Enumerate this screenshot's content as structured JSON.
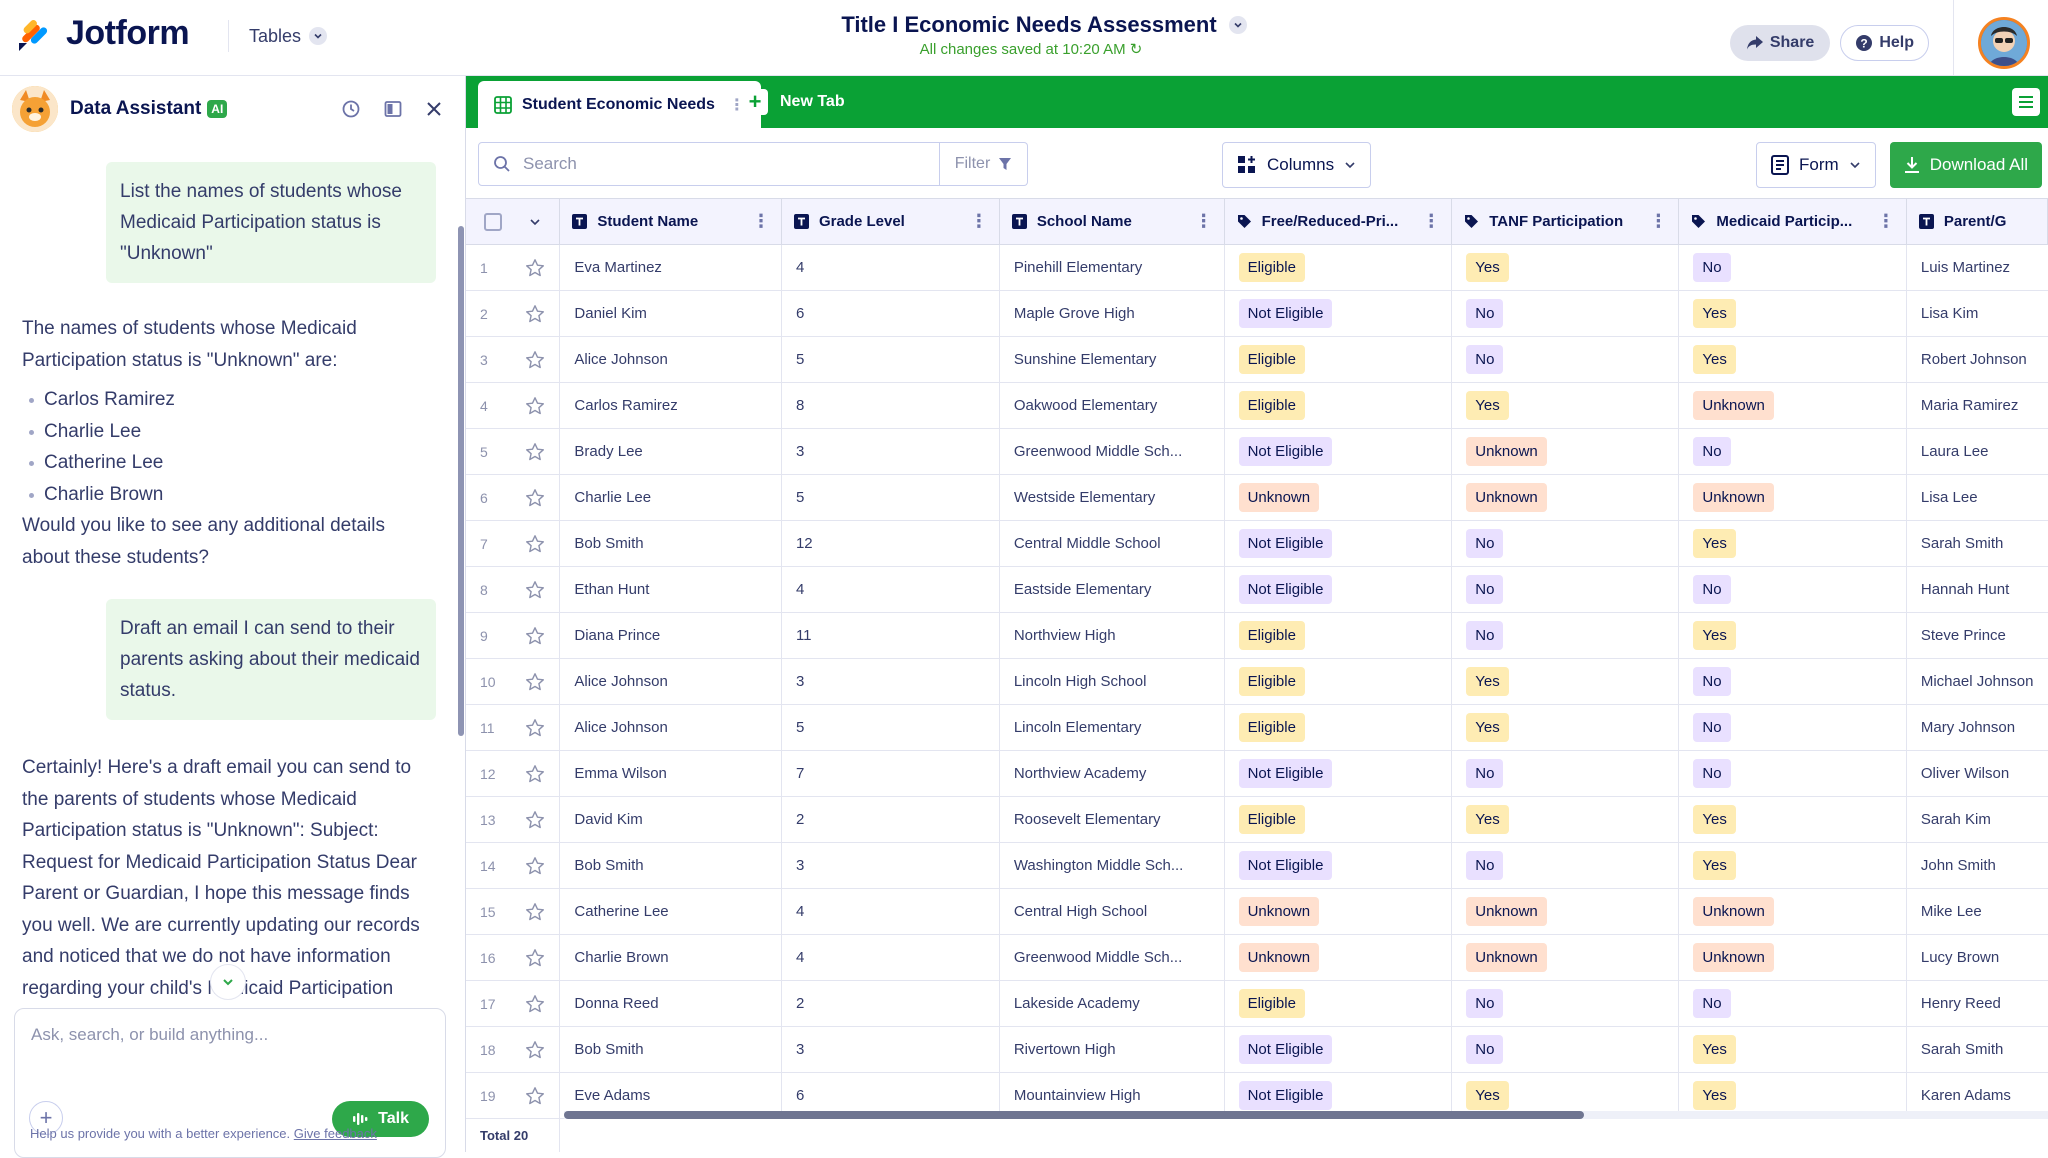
{
  "app": {
    "brand": "Jotform",
    "menu_label": "Tables"
  },
  "document": {
    "title": "Title I Economic Needs Assessment",
    "saved_status": "All changes saved at 10:20 AM"
  },
  "header_actions": {
    "share": "Share",
    "help": "Help"
  },
  "assistant": {
    "name": "Data Assistant",
    "badge": "AI",
    "messages": [
      {
        "role": "user",
        "text": "List the names of students whose Medicaid Participation status is \"Unknown\""
      },
      {
        "role": "assistant",
        "text": "The names of students whose Medicaid Participation status is \"Unknown\" are:",
        "list": [
          "Carlos Ramirez",
          "Charlie Lee",
          "Catherine Lee",
          "Charlie Brown"
        ],
        "after": "Would you like to see any additional details about these students?"
      },
      {
        "role": "user",
        "text": "Draft an email I can send to their parents asking about their medicaid status."
      },
      {
        "role": "assistant",
        "text": "Certainly! Here's a draft email you can send to the parents of students whose Medicaid Participation status is \"Unknown\": Subject: Request for Medicaid Participation Status Dear Parent or Guardian, I hope this message finds you well. We are currently updating our records and noticed that we do not have information regarding your child's Medicaid Participation"
      }
    ],
    "input_placeholder": "Ask, search, or build anything...",
    "talk_label": "Talk",
    "feedback_text": "Help us provide you with a better experience.",
    "feedback_link": "Give feedback"
  },
  "tabs": {
    "active": "Student Economic Needs",
    "new_tab": "New Tab"
  },
  "toolbar": {
    "search_placeholder": "Search",
    "filter": "Filter",
    "columns": "Columns",
    "form": "Form",
    "download": "Download All"
  },
  "table": {
    "columns": [
      "Student Name",
      "Grade Level",
      "School Name",
      "Free/Reduced-Pri...",
      "TANF Participation",
      "Medicaid Particip...",
      "Parent/G"
    ],
    "rows": [
      {
        "num": "1",
        "name": "Eva Martinez",
        "grade": "4",
        "school": "Pinehill Elementary",
        "frl": "Eligible",
        "tanf": "Yes",
        "medicaid": "No",
        "parent": "Luis Martinez"
      },
      {
        "num": "2",
        "name": "Daniel Kim",
        "grade": "6",
        "school": "Maple Grove High",
        "frl": "Not Eligible",
        "tanf": "No",
        "medicaid": "Yes",
        "parent": "Lisa Kim"
      },
      {
        "num": "3",
        "name": "Alice Johnson",
        "grade": "5",
        "school": "Sunshine Elementary",
        "frl": "Eligible",
        "tanf": "No",
        "medicaid": "Yes",
        "parent": "Robert Johnson"
      },
      {
        "num": "4",
        "name": "Carlos Ramirez",
        "grade": "8",
        "school": "Oakwood Elementary",
        "frl": "Eligible",
        "tanf": "Yes",
        "medicaid": "Unknown",
        "parent": "Maria Ramirez"
      },
      {
        "num": "5",
        "name": "Brady Lee",
        "grade": "3",
        "school": "Greenwood Middle Sch...",
        "frl": "Not Eligible",
        "tanf": "Unknown",
        "medicaid": "No",
        "parent": "Laura Lee"
      },
      {
        "num": "6",
        "name": "Charlie Lee",
        "grade": "5",
        "school": "Westside Elementary",
        "frl": "Unknown",
        "tanf": "Unknown",
        "medicaid": "Unknown",
        "parent": "Lisa Lee"
      },
      {
        "num": "7",
        "name": "Bob Smith",
        "grade": "12",
        "school": "Central Middle School",
        "frl": "Not Eligible",
        "tanf": "No",
        "medicaid": "Yes",
        "parent": "Sarah Smith"
      },
      {
        "num": "8",
        "name": "Ethan Hunt",
        "grade": "4",
        "school": "Eastside Elementary",
        "frl": "Not Eligible",
        "tanf": "No",
        "medicaid": "No",
        "parent": "Hannah Hunt"
      },
      {
        "num": "9",
        "name": "Diana Prince",
        "grade": "11",
        "school": "Northview High",
        "frl": "Eligible",
        "tanf": "No",
        "medicaid": "Yes",
        "parent": "Steve Prince"
      },
      {
        "num": "10",
        "name": "Alice Johnson",
        "grade": "3",
        "school": "Lincoln High School",
        "frl": "Eligible",
        "tanf": "Yes",
        "medicaid": "No",
        "parent": "Michael Johnson"
      },
      {
        "num": "11",
        "name": "Alice Johnson",
        "grade": "5",
        "school": "Lincoln Elementary",
        "frl": "Eligible",
        "tanf": "Yes",
        "medicaid": "No",
        "parent": "Mary Johnson"
      },
      {
        "num": "12",
        "name": "Emma Wilson",
        "grade": "7",
        "school": "Northview Academy",
        "frl": "Not Eligible",
        "tanf": "No",
        "medicaid": "No",
        "parent": "Oliver Wilson"
      },
      {
        "num": "13",
        "name": "David Kim",
        "grade": "2",
        "school": "Roosevelt Elementary",
        "frl": "Eligible",
        "tanf": "Yes",
        "medicaid": "Yes",
        "parent": "Sarah Kim"
      },
      {
        "num": "14",
        "name": "Bob Smith",
        "grade": "3",
        "school": "Washington Middle Sch...",
        "frl": "Not Eligible",
        "tanf": "No",
        "medicaid": "Yes",
        "parent": "John Smith"
      },
      {
        "num": "15",
        "name": "Catherine Lee",
        "grade": "4",
        "school": "Central High School",
        "frl": "Unknown",
        "tanf": "Unknown",
        "medicaid": "Unknown",
        "parent": "Mike Lee"
      },
      {
        "num": "16",
        "name": "Charlie Brown",
        "grade": "4",
        "school": "Greenwood Middle Sch...",
        "frl": "Unknown",
        "tanf": "Unknown",
        "medicaid": "Unknown",
        "parent": "Lucy Brown"
      },
      {
        "num": "17",
        "name": "Donna Reed",
        "grade": "2",
        "school": "Lakeside Academy",
        "frl": "Eligible",
        "tanf": "No",
        "medicaid": "No",
        "parent": "Henry Reed"
      },
      {
        "num": "18",
        "name": "Bob Smith",
        "grade": "3",
        "school": "Rivertown High",
        "frl": "Not Eligible",
        "tanf": "No",
        "medicaid": "Yes",
        "parent": "Sarah Smith"
      },
      {
        "num": "19",
        "name": "Eve Adams",
        "grade": "6",
        "school": "Mountainview High",
        "frl": "Not Eligible",
        "tanf": "Yes",
        "medicaid": "Yes",
        "parent": "Karen Adams"
      }
    ],
    "total_label": "Total",
    "total_count": "20"
  },
  "colors": {
    "brand_green": "#0aa135",
    "accent_green": "#2ea84a",
    "navy": "#0a1551"
  }
}
